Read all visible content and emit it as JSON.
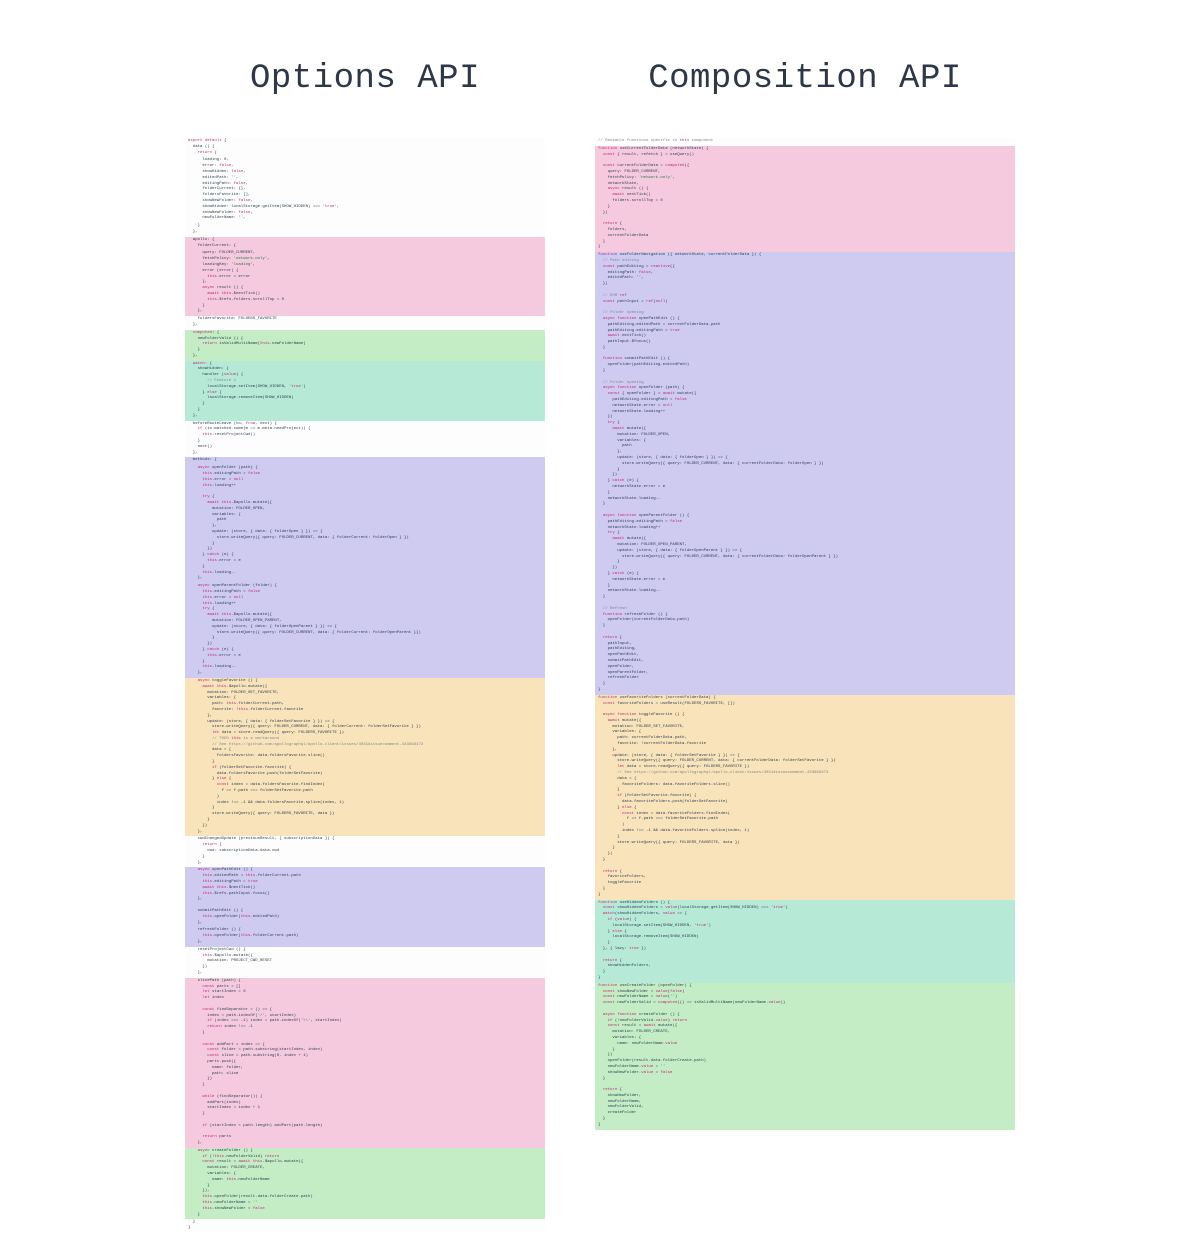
{
  "titles": {
    "left": "Options API",
    "right": "Composition API"
  },
  "options": {
    "header": "export default {\n  data () {\n    return {",
    "data_body": "      loading: 0,\n      error: false,\n      showHidden: false,\n      editedPath: '',\n      editingPath: false,\n      folderCurrent: {},\n      foldersFavorite: [],\n      showNewFolder: false,\n      showHidden: localStorage.getItem(SHOW_HIDDEN) === 'true',\n      showNewFolder: false,\n      newFolderName: '',",
    "data_close": "    }\n  },\n",
    "apollo_open": "  apollo: {\n    folderCurrent: {",
    "apollo_body": "      query: FOLDER_CURRENT,\n      fetchPolicy: 'network-only',\n      loadingKey: 'loading',\n      error (error) {\n        this.error = error\n      },\n      async result () {\n        await this.$nextTick()\n        this.$refs.folders.scrollTop = 0\n      }\n    },",
    "apollo_fav": "    foldersFavorite: FOLDERS_FAVORITE\n  },\n",
    "computed": "  computed: {\n    newFolderValid () {\n      return isValidMultiName(this.newFolderName)\n    }\n  },\n",
    "watch": "  watch: {\n    showHidden: {\n      handler (value) {\n        // Feature 1\n        localStorage.setItem(SHOW_HIDDEN, 'true')\n      } else {\n        localStorage.removeItem(SHOW_HIDDEN)\n      }\n    }\n  },\n",
    "update_hook": "  beforeRouteLeave (to, from, next) {\n    if (to.matched.some(m => m.meta.needProject)) {\n      this.resetProjectCwd()\n    }\n    next()\n  },\n",
    "methods_open": "  methods: {",
    "open_folder": "    async openFolder (path) {\n      this.editingPath = false\n      this.error = null\n      this.loading++\n\n      try {\n        await this.$apollo.mutate({\n          mutation: FOLDER_OPEN,\n          variables: {\n            path\n          },\n          update: (store, { data: { folderOpen } }) => {\n            store.writeQuery({ query: FOLDER_CURRENT, data: { folderCurrent: folderOpen } })\n          }\n        })\n      } catch (e) {\n        this.error = e\n      }\n      this.loading--\n    },\n",
    "open_parent": "    async openParentFolder (folder) {\n      this.editingPath = false\n      this.error = null\n      this.loading++\n      try {\n        await this.$apollo.mutate({\n          mutation: FOLDER_OPEN_PARENT,\n          update: (store, { data: { folderOpenParent } }) => {\n            store.writeQuery({ query: FOLDER_CURRENT, data: { folderCurrent: folderOpenParent }})\n          }\n        })\n      } catch (e) {\n        this.error = e\n      }\n      this.loading--\n    },\n",
    "toggle_favorite": "    async toggleFavorite () {\n      await this.$apollo.mutate({\n        mutation: FOLDER_SET_FAVORITE,\n        variables: {\n          path: this.folderCurrent.path,\n          favorite: !this.folderCurrent.favorite\n        },\n        update: (store, { data: { folderSetFavorite } }) => {\n          store.writeQuery({ query: FOLDER_CURRENT, data: { folderCurrent: folderSetFavorite } })\n          let data = store.readQuery({ query: FOLDERS_FAVORITE })\n          // TODO this is a workaround\n          // See https://github.com/apollographql/apollo-client/issues/4031#issuecomment-433668473\n          data = {\n            foldersFavorite: data.foldersFavorite.slice()\n          }\n          if (folderSetFavorite.favorite) {\n            data.foldersFavorite.push(folderSetFavorite)\n          } else {\n            const index = data.foldersFavorite.findIndex(\n              f => f.path === folderSetFavorite.path\n            )\n            index !== -1 && data.foldersFavorite.splice(index, 1)\n          }\n          store.writeQuery({ query: FOLDERS_FAVORITE, data })\n        }\n      })\n    },\n",
    "cwd_changed": "    cwdChangedUpdate (previousResult, { subscriptionData }) {\n      return {\n        cwd: subscriptionData.data.cwd\n      }\n    },\n",
    "open_edit_path": "    async openPathEdit () {\n      this.editedPath = this.folderCurrent.path\n      this.editingPath = true\n      await this.$nextTick()\n      this.$refs.pathInput.focus()\n    },\n\n    submitPathEdit () {\n      this.openFolder(this.editedPath)\n    },\n",
    "refresh": "    refreshFolder () {\n      this.openFolder(this.folderCurrent.path)\n    },\n",
    "reset_cwd": "    resetProjectCwd () {\n      this.$apollo.mutate({\n        mutation: PROJECT_CWD_RESET\n      })\n    },\n",
    "slice_path": "    slicePath (path) {\n      const parts = []\n      let startIndex = 0\n      let index\n\n      const findSeparator = () => {\n        index = path.indexOf('/', startIndex)\n        if (index === -1) index = path.indexOf('\\\\', startIndex)\n        return index !== -1\n      }\n\n      const addPart = index => {\n        const folder = path.substring(startIndex, index)\n        const slice = path.substring(0, index + 1)\n        parts.push({\n          name: folder,\n          path: slice\n        })\n      }\n\n      while (findSeparator()) {\n        addPart(index)\n        startIndex = index + 1\n      }\n\n      if (startIndex < path.length) addPart(path.length)\n\n      return parts\n    },\n",
    "create_folder": "    async createFolder () {\n      if (!this.newFolderValid) return\n      const result = await this.$apollo.mutate({\n        mutation: FOLDER_CREATE,\n        variables: {\n          name: this.newFolderName\n        }\n      }),\n      this.openFolder(result.data.folderCreate.path)\n      this.newFolderName = ''\n      this.showNewFolder = false\n    }",
    "close": "  }\n}"
  },
  "composition": {
    "network_comment": "// Reusable functions specific to this component",
    "network_state": "function useCurrentFolderData (networkState) {\n  const { result, refetch } = useQuery()\n\n  const currentFolderData = computed({\n    query: FOLDER_CURRENT,\n    fetchPolicy: 'network-only',\n    networkState,\n    async result () {\n      await nextTick()\n      folders.scrollTop = 0\n    }\n  })\n\n  return {\n    folders,\n    currentFolderData\n  }\n}\n",
    "navigation": "function useFolderNavigation ({ networkState, currentFolderData }) {\n  // Path editing\n  const pathEditing = reactive({\n    editingPath: false,\n    editedPath: '',\n  })\n\n  // DOM ref\n  const pathInput = ref(null)\n\n  // Folder opening\n  async function openPathEdit () {\n    pathEditing.editedPath = currentFolderData.path\n    pathEditing.editingPath = true\n    await nextTick()\n    pathInput.$focus()\n  }\n\n  function submitPathEdit () {\n    openFolder(pathEditing.editedPath)\n  }\n\n  // Folder opening\n  async function openFolder (path) {\n    const { openFolder } = await mutate({\n      pathEditing.editingPath = false\n      networkState.error = null\n      networkState.loading++\n    })\n    try {\n      await mutate({\n        mutation: FOLDER_OPEN,\n        variables: {\n          path\n        },\n        update: (store, { data: { folderOpen } }) => {\n          store.writeQuery({ query: FOLDER_CURRENT, data: { currentFolderData: folderOpen } })\n        }\n      })\n    } catch (e) {\n      networkState.error = e\n    }\n    networkState.loading--\n  }\n\n  async function openParentFolder () {\n    pathEditing.editingPath = false\n    networkState.loading++\n    try {\n      await mutate({\n        mutation: FOLDER_OPEN_PARENT,\n        update: (store, { data: { folderOpenParent } }) => {\n          store.writeQuery({ query: FOLDER_CURRENT, data: { currentFolderData: folderOpenParent } })\n        }\n      })\n    } catch (e) {\n      networkState.error = e\n    }\n    networkState.loading--\n  }\n\n  // Refresh\n  function refreshFolder () {\n    openFolder(currentFolderData.path)\n  }\n\n  return {\n    pathInput,\n    pathEditing,\n    openPathEdit,\n    submitPathEdit,\n    openFolder,\n    openParentFolder,\n    refreshFolder\n  }\n}\n",
    "favorite": "function useFavoriteFolders (currentFolderData) {\n  const favoriteFolders = useResult(FOLDERS_FAVORITE, [])\n\n  async function toggleFavorite () {\n    await mutate({\n      mutation: FOLDER_SET_FAVORITE,\n      variables: {\n        path: currentFolderData.path,\n        favorite: !currentFolderData.favorite\n      },\n      update: (store, { data: { folderSetFavorite } }) => {\n        store.writeQuery({ query: FOLDER_CURRENT, data: { currentFolderData: folderSetFavorite } })\n        let data = store.readQuery({ query: FOLDERS_FAVORITE })\n        // See https://github.com/apollographql/apollo-client/issues/4031#issuecomment-433668473\n        data = {\n          favoriteFolders: data.favoriteFolders.slice()\n        }\n        if (folderSetFavorite.favorite) {\n          data.favoriteFolders.push(folderSetFavorite)\n        } else {\n          const index = data.favoriteFolders.findIndex(\n            f => f.path === folderSetFavorite.path\n          )\n          index !== -1 && data.favoriteFolders.splice(index, 1)\n        }\n        store.writeQuery({ query: FOLDERS_FAVORITE, data })\n      }\n    })\n  }\n\n  return {\n    favoriteFolders,\n    toggleFavorite\n  }\n}\n",
    "hidden_folders": "function useHiddenFolders () {\n  const showHiddenFolders = value(localStorage.getItem(SHOW_HIDDEN) === 'true')\n  watch(showHiddenFolders, value => {\n    if (value) {\n      localStorage.setItem(SHOW_HIDDEN, 'true')\n    } else {\n      localStorage.removeItem(SHOW_HIDDEN)\n    }\n  }, { lazy: true })\n\n  return {\n    showHiddenFolders,\n  }\n}\n",
    "create_folder": "function useCreateFolder (openFolder) {\n  const showNewFolder = value(false)\n  const newFolderName = value('')\n  const newFolderValid = computed(() => isValidMultiName(newFolderName.value))\n\n  async function createFolder () {\n    if (!newFolderValid.value) return\n    const result = await mutate({\n      mutation: FOLDER_CREATE,\n      variables: {\n        name: newFolderName.value\n      }\n    })\n    openFolder(result.data.folderCreate.path)\n    newFolderName.value = ''\n    showNewFolder.value = false\n  }\n\n  return {\n    showNewFolder,\n    newFolderName,\n    newFolderValid,\n    createFolder\n  }\n}"
  }
}
